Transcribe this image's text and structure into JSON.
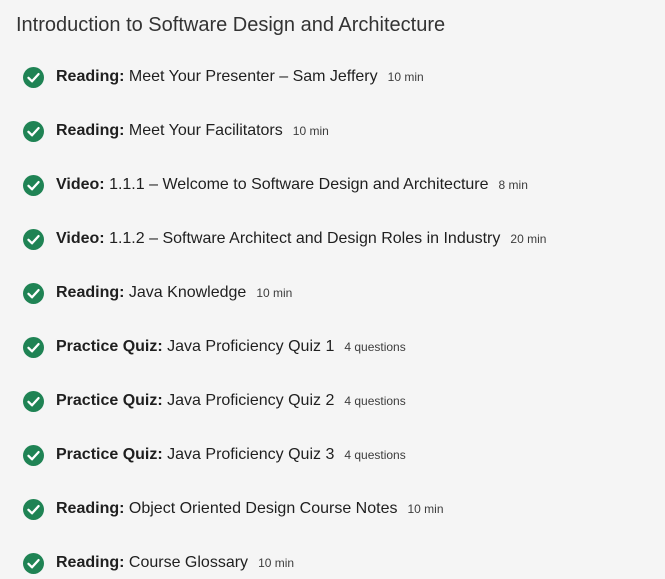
{
  "module": {
    "title": "Introduction to Software Design and Architecture"
  },
  "colors": {
    "check": "#1f8354",
    "page_background": "#f5f5f5"
  },
  "items": [
    {
      "icon": "check-circle-icon",
      "completed": true,
      "type": "Reading:",
      "name": "Meet Your Presenter – Sam Jeffery",
      "meta": "10 min"
    },
    {
      "icon": "check-circle-icon",
      "completed": true,
      "type": "Reading:",
      "name": "Meet Your Facilitators",
      "meta": "10 min"
    },
    {
      "icon": "check-circle-icon",
      "completed": true,
      "type": "Video:",
      "name": "1.1.1 – Welcome to Software Design and Architecture",
      "meta": "8 min"
    },
    {
      "icon": "check-circle-icon",
      "completed": true,
      "type": "Video:",
      "name": "1.1.2 – Software Architect and Design Roles in Industry",
      "meta": "20 min"
    },
    {
      "icon": "check-circle-icon",
      "completed": true,
      "type": "Reading:",
      "name": "Java Knowledge",
      "meta": "10 min"
    },
    {
      "icon": "check-circle-icon",
      "completed": true,
      "type": "Practice Quiz:",
      "name": "Java Proficiency Quiz 1",
      "meta": "4 questions"
    },
    {
      "icon": "check-circle-icon",
      "completed": true,
      "type": "Practice Quiz:",
      "name": "Java Proficiency Quiz 2",
      "meta": "4 questions"
    },
    {
      "icon": "check-circle-icon",
      "completed": true,
      "type": "Practice Quiz:",
      "name": "Java Proficiency Quiz 3",
      "meta": "4 questions"
    },
    {
      "icon": "check-circle-icon",
      "completed": true,
      "type": "Reading:",
      "name": "Object Oriented Design Course Notes",
      "meta": "10 min"
    },
    {
      "icon": "check-circle-icon",
      "completed": true,
      "type": "Reading:",
      "name": "Course Glossary",
      "meta": "10 min"
    }
  ]
}
